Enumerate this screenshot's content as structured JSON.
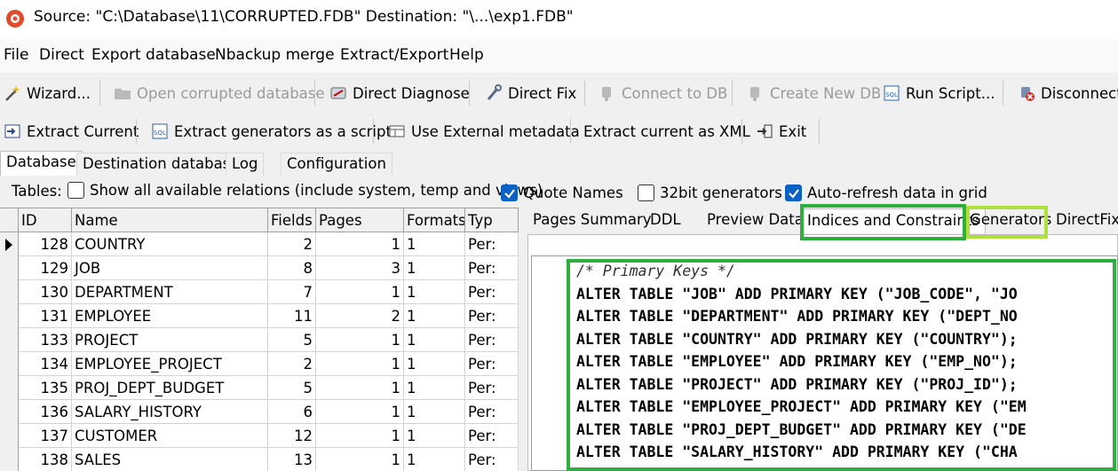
{
  "window": {
    "title": "Source: \"C:\\Database\\11\\CORRUPTED.FDB\" Destination: \"\\...\\exp1.FDB\""
  },
  "menu": [
    "File",
    "Direct",
    "Export database",
    "Nbackup merge",
    "Extract/Export",
    "Help"
  ],
  "toolbar1": {
    "wizard": "Wizard...",
    "open_corrupted": "Open corrupted database",
    "direct_diagnose": "Direct Diagnose",
    "direct_fix": "Direct Fix",
    "connect_db": "Connect to DB",
    "create_new_db": "Create New DB",
    "run_script": "Run Script...",
    "disconnect": "Disconnect"
  },
  "toolbar2": {
    "extract_current": "Extract Current",
    "extract_generators": "Extract generators as a script",
    "use_external_metadata": "Use External metadata",
    "extract_xml": "Extract current as XML",
    "exit": "Exit"
  },
  "main_tabs": [
    "Database",
    "Destination database",
    "Log",
    "Configuration"
  ],
  "options": {
    "tables_label": "Tables:",
    "show_all": "Show all available relations (include system, temp and views)",
    "quote_names": "Quote Names",
    "gen32": "32bit generators",
    "auto_refresh": "Auto-refresh data in grid"
  },
  "grid": {
    "columns": [
      "ID",
      "Name",
      "Fields",
      "Pages",
      "Formats",
      "Typ"
    ],
    "rows": [
      {
        "id": "128",
        "name": "COUNTRY",
        "fields": "2",
        "pages": "1",
        "formats": "1",
        "type": "Per:"
      },
      {
        "id": "129",
        "name": "JOB",
        "fields": "8",
        "pages": "3",
        "formats": "1",
        "type": "Per:"
      },
      {
        "id": "130",
        "name": "DEPARTMENT",
        "fields": "7",
        "pages": "1",
        "formats": "1",
        "type": "Per:"
      },
      {
        "id": "131",
        "name": "EMPLOYEE",
        "fields": "11",
        "pages": "2",
        "formats": "1",
        "type": "Per:"
      },
      {
        "id": "133",
        "name": "PROJECT",
        "fields": "5",
        "pages": "1",
        "formats": "1",
        "type": "Per:"
      },
      {
        "id": "134",
        "name": "EMPLOYEE_PROJECT",
        "fields": "2",
        "pages": "1",
        "formats": "1",
        "type": "Per:"
      },
      {
        "id": "135",
        "name": "PROJ_DEPT_BUDGET",
        "fields": "5",
        "pages": "1",
        "formats": "1",
        "type": "Per:"
      },
      {
        "id": "136",
        "name": "SALARY_HISTORY",
        "fields": "6",
        "pages": "1",
        "formats": "1",
        "type": "Per:"
      },
      {
        "id": "137",
        "name": "CUSTOMER",
        "fields": "12",
        "pages": "1",
        "formats": "1",
        "type": "Per:"
      },
      {
        "id": "138",
        "name": "SALES",
        "fields": "13",
        "pages": "1",
        "formats": "1",
        "type": "Per:"
      }
    ]
  },
  "sub_tabs": [
    "Pages Summary",
    "DDL",
    "Preview Data",
    "Indices and Constraints",
    "Generators",
    "DirectFix"
  ],
  "code_lines": [
    "/* Primary Keys */",
    "ALTER TABLE \"JOB\" ADD PRIMARY KEY (\"JOB_CODE\", \"JO",
    "ALTER TABLE \"DEPARTMENT\" ADD PRIMARY KEY (\"DEPT_NO",
    "ALTER TABLE \"COUNTRY\" ADD PRIMARY KEY (\"COUNTRY\");",
    "ALTER TABLE \"EMPLOYEE\" ADD PRIMARY KEY (\"EMP_NO\");",
    "ALTER TABLE \"PROJECT\" ADD PRIMARY KEY (\"PROJ_ID\");",
    "ALTER TABLE \"EMPLOYEE_PROJECT\" ADD PRIMARY KEY (\"EM",
    "ALTER TABLE \"PROJ_DEPT_BUDGET\" ADD PRIMARY KEY (\"DE",
    "ALTER TABLE \"SALARY_HISTORY\" ADD PRIMARY KEY (\"CHA"
  ],
  "colors": {
    "highlight_green": "#2eae3c",
    "highlight_lime": "#aee23a",
    "checkbox_blue": "#0b61c4"
  }
}
